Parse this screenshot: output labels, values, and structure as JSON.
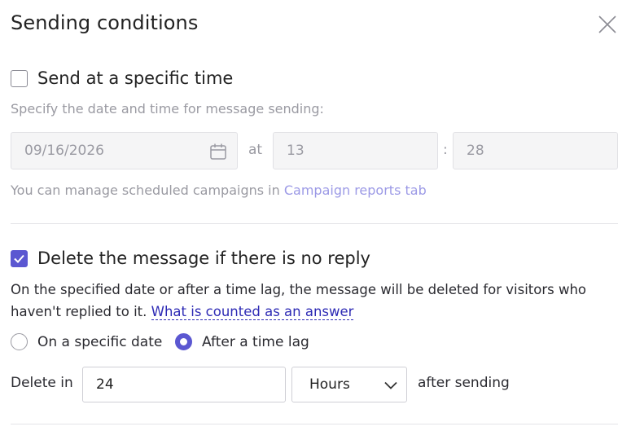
{
  "dialog": {
    "title": "Sending conditions"
  },
  "schedule": {
    "checkbox_label": "Send at a specific time",
    "checked": false,
    "hint": "Specify the date and time for message sending:",
    "date_value": "09/16/2026",
    "at_label": "at",
    "hours_value": "13",
    "colon": ":",
    "minutes_value": "28",
    "manage_text": "You can manage scheduled campaigns in ",
    "manage_link": "Campaign reports tab"
  },
  "delete": {
    "checkbox_label": "Delete the message if there is no reply",
    "checked": true,
    "description": "On the specified date or after a time lag, the message will be deleted for visitors who haven't replied to it. ",
    "answer_link": "What is counted as an answer",
    "options": [
      {
        "label": "On a specific date",
        "selected": false
      },
      {
        "label": "After a time lag",
        "selected": true
      }
    ],
    "delete_in_label": "Delete in",
    "amount_value": "24",
    "unit_selected": "Hours",
    "after_label": "after sending"
  },
  "colors": {
    "accent": "#5b57d1",
    "link": "#2e2bb5",
    "link_muted": "#9c9ae6"
  },
  "icons": {
    "close": "close-icon",
    "calendar": "calendar-icon",
    "checkmark": "checkmark-icon",
    "chevron": "chevron-down-icon"
  }
}
